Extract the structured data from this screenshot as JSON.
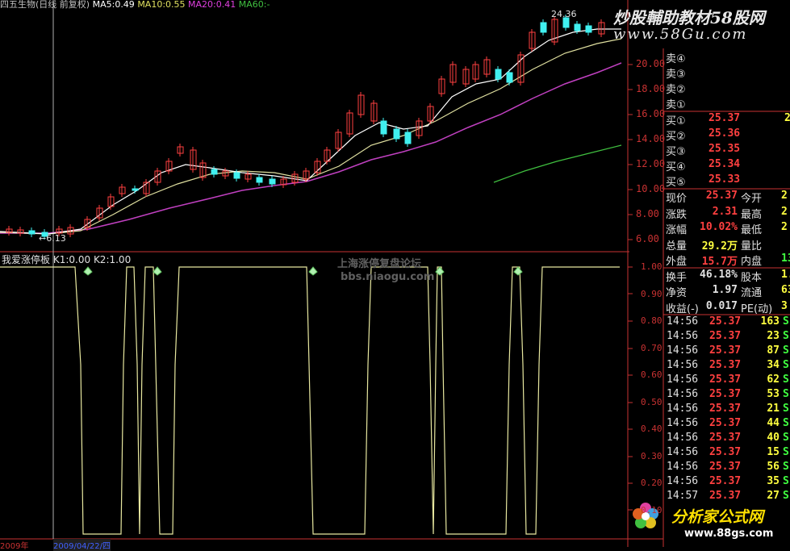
{
  "top_header": {
    "stock": "四五生物(日线 前复权)",
    "ma5": "MA5:0.49",
    "ma10": "MA10:0.55",
    "ma20": "MA20:0.41",
    "ma60": "MA60:-",
    "peak_label": "24.36",
    "low_label": "←6.13"
  },
  "watermark": {
    "brand": "炒股輔助教材58股网",
    "url": "www.58Gu.com",
    "middle": "上海涨停复盘论坛",
    "middle2": "bbs.niaogu.com",
    "corner_brand": "分析家公式网",
    "corner_url": "www.88gs.com"
  },
  "indicator_header": {
    "name": "我爱涨停板",
    "k1": "K1:0.00",
    "k2": "K2:1.00"
  },
  "price_axis": [
    "20.00",
    "18.00",
    "16.00",
    "14.00",
    "12.00",
    "10.00",
    "8.00",
    "6.00"
  ],
  "ind_axis": [
    "1.00",
    "0.90",
    "0.80",
    "0.70",
    "0.60",
    "0.50",
    "0.40",
    "0.30",
    "0.20",
    "0.10"
  ],
  "bottom_bar": {
    "date_left": "2009年",
    "date_cursor": "2009/04/22/四"
  },
  "order_book": {
    "sell": [
      "卖④",
      "卖③",
      "卖②",
      "卖①"
    ],
    "buy": [
      {
        "label": "买①",
        "price": "25.37",
        "vol": "2"
      },
      {
        "label": "买②",
        "price": "25.36",
        "vol": ""
      },
      {
        "label": "买③",
        "price": "25.35",
        "vol": ""
      },
      {
        "label": "买④",
        "price": "25.34",
        "vol": ""
      },
      {
        "label": "买⑤",
        "price": "25.33",
        "vol": ""
      }
    ]
  },
  "quote": [
    {
      "k1": "现价",
      "v1": "25.37",
      "k2": "今开",
      "v2": "2"
    },
    {
      "k1": "涨跌",
      "v1": "2.31",
      "k2": "最高",
      "v2": "2"
    },
    {
      "k1": "涨幅",
      "v1": "10.02%",
      "k2": "最低",
      "v2": "2"
    },
    {
      "k1": "总量",
      "v1": "29.2万",
      "k2": "量比",
      "v2": ""
    },
    {
      "k1": "外盘",
      "v1": "15.7万",
      "k2": "内盘",
      "v2": "13"
    },
    {
      "k1": "换手",
      "v1": "46.18%",
      "k2": "股本",
      "v2": "1."
    },
    {
      "k1": "净资",
      "v1": "1.97",
      "k2": "流通",
      "v2": "63"
    },
    {
      "k1": "收益(-)",
      "v1": "0.017",
      "k2": "PE(动)",
      "v2": "3"
    }
  ],
  "ticks": [
    {
      "t": "14:56",
      "p": "25.37",
      "v": "163",
      "s": "S"
    },
    {
      "t": "14:56",
      "p": "25.37",
      "v": "23",
      "s": "S"
    },
    {
      "t": "14:56",
      "p": "25.37",
      "v": "87",
      "s": "S"
    },
    {
      "t": "14:56",
      "p": "25.37",
      "v": "34",
      "s": "S"
    },
    {
      "t": "14:56",
      "p": "25.37",
      "v": "62",
      "s": "S"
    },
    {
      "t": "14:56",
      "p": "25.37",
      "v": "53",
      "s": "S"
    },
    {
      "t": "14:56",
      "p": "25.37",
      "v": "21",
      "s": "S"
    },
    {
      "t": "14:56",
      "p": "25.37",
      "v": "44",
      "s": "S"
    },
    {
      "t": "14:56",
      "p": "25.37",
      "v": "40",
      "s": "S"
    },
    {
      "t": "14:56",
      "p": "25.37",
      "v": "15",
      "s": "S"
    },
    {
      "t": "14:56",
      "p": "25.37",
      "v": "56",
      "s": "S"
    },
    {
      "t": "14:56",
      "p": "25.37",
      "v": "35",
      "s": "S"
    },
    {
      "t": "14:57",
      "p": "25.37",
      "v": "27",
      "s": "S"
    }
  ]
}
